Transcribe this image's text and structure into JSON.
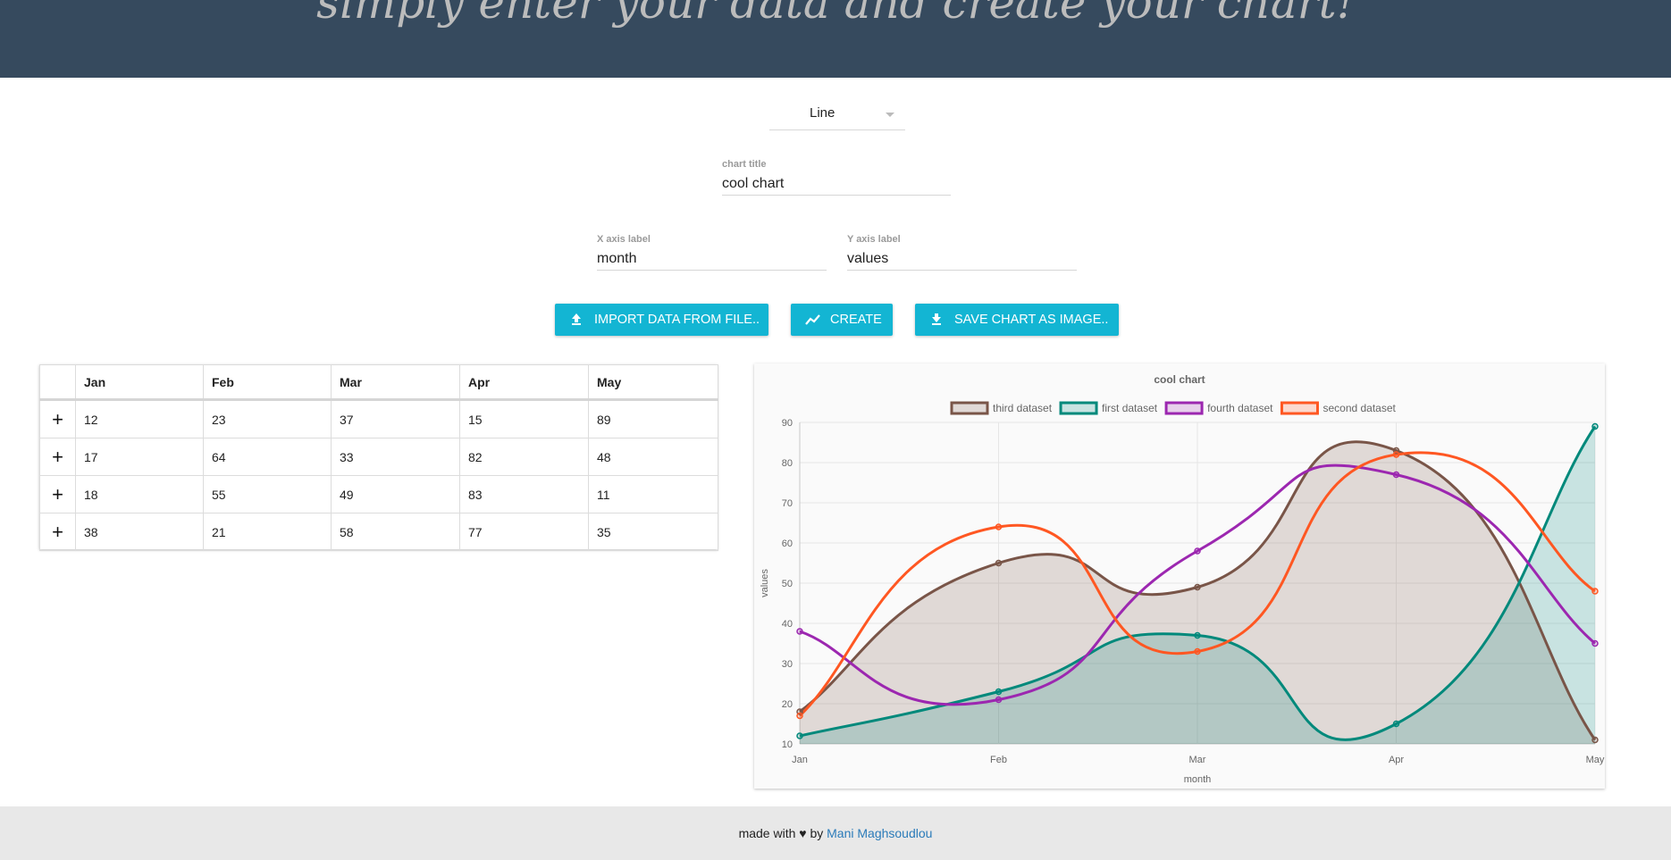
{
  "header": {
    "title": "simply enter your data and create your chart!"
  },
  "chart_type_select": {
    "value": "Line"
  },
  "chart_title_field": {
    "label": "chart title",
    "value": "cool chart"
  },
  "x_axis_field": {
    "label": "X axis label",
    "value": "month"
  },
  "y_axis_field": {
    "label": "Y axis label",
    "value": "values"
  },
  "buttons": {
    "import": "IMPORT DATA FROM FILE..",
    "create": "CREATE",
    "save": "SAVE CHART AS IMAGE.."
  },
  "table": {
    "add_symbol": "+",
    "columns": [
      "Jan",
      "Feb",
      "Mar",
      "Apr",
      "May"
    ],
    "rows": [
      [
        "12",
        "23",
        "37",
        "15",
        "89"
      ],
      [
        "17",
        "64",
        "33",
        "82",
        "48"
      ],
      [
        "18",
        "55",
        "49",
        "83",
        "11"
      ],
      [
        "38",
        "21",
        "58",
        "77",
        "35"
      ]
    ]
  },
  "chart_data": {
    "type": "line",
    "title": "cool chart",
    "xlabel": "month",
    "ylabel": "values",
    "categories": [
      "Jan",
      "Feb",
      "Mar",
      "Apr",
      "May"
    ],
    "ylim": [
      10,
      90
    ],
    "yticks": [
      10,
      20,
      30,
      40,
      50,
      60,
      70,
      80,
      90
    ],
    "grid": true,
    "legend_position": "top",
    "series": [
      {
        "name": "third dataset",
        "values": [
          18,
          55,
          49,
          83,
          11
        ],
        "color": "#795548",
        "fill": "rgba(121,85,72,0.2)"
      },
      {
        "name": "first dataset",
        "values": [
          12,
          23,
          37,
          15,
          89
        ],
        "color": "#00897b",
        "fill": "rgba(0,137,123,0.2)"
      },
      {
        "name": "fourth dataset",
        "values": [
          38,
          21,
          58,
          77,
          35
        ],
        "color": "#9c27b0",
        "fill": "rgba(156,39,176,0.2)"
      },
      {
        "name": "second dataset",
        "values": [
          17,
          64,
          33,
          82,
          48
        ],
        "color": "#ff5722",
        "fill": "rgba(255,87,34,0.2)"
      }
    ]
  },
  "footer": {
    "text": "made with ♥ by",
    "author": "Mani Maghsoudlou"
  },
  "colors": {
    "header_bg": "#364a5e",
    "accent": "#13b5d3",
    "footer_bg": "#e8e8e8",
    "link": "#2b7bb9"
  }
}
